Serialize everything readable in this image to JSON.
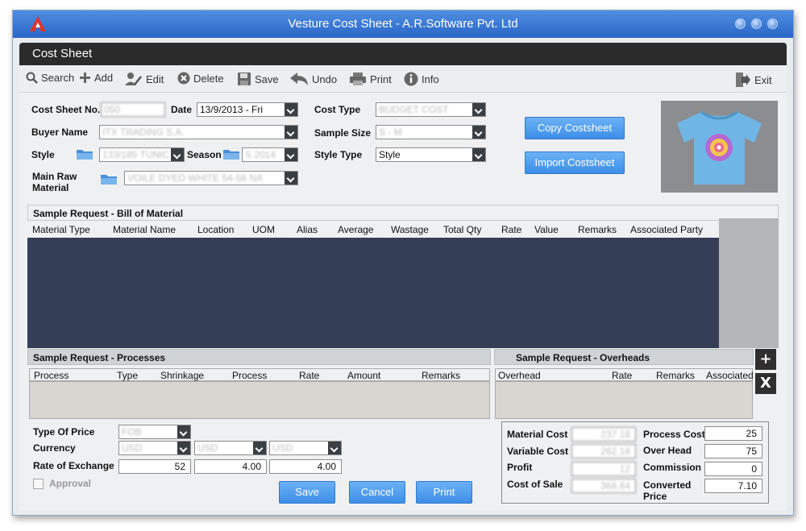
{
  "window": {
    "title": "Vesture Cost Sheet - A.R.Software Pvt. Ltd"
  },
  "panel": {
    "title": "Cost Sheet"
  },
  "toolbar": {
    "search": "Search",
    "add": "Add",
    "edit": "Edit",
    "delete": "Delete",
    "save": "Save",
    "undo": "Undo",
    "print": "Print",
    "info": "Info",
    "exit": "Exit"
  },
  "form": {
    "cost_sheet_no_label": "Cost Sheet No.",
    "cost_sheet_no": "050",
    "date_label": "Date",
    "date": "13/9/2013 - Fri",
    "cost_type_label": "Cost Type",
    "cost_type": "BUDGET COST",
    "buyer_name_label": "Buyer Name",
    "buyer_name": "ITX TRADING S.A.",
    "sample_size_label": "Sample Size",
    "sample_size": "S - M",
    "style_label": "Style",
    "style": "133/185 TUNIC",
    "season_label": "Season",
    "season": "S 2014",
    "style_type_label": "Style Type",
    "style_type": "Style",
    "main_raw_material_label": "Main Raw Material",
    "main_raw_material": "VOILE DYED WHITE 54-56 NA"
  },
  "buttons": {
    "copy": "Copy Costsheet",
    "import": "Import Costsheet",
    "save": "Save",
    "cancel": "Cancel",
    "print": "Print"
  },
  "bom": {
    "title": "Sample Request - Bill of Material",
    "columns": [
      "Material Type",
      "Material Name",
      "Location",
      "UOM",
      "Alias",
      "Average",
      "Wastage",
      "Total Qty",
      "Rate",
      "Value",
      "Remarks",
      "Associated Party"
    ]
  },
  "processes": {
    "title": "Sample Request - Processes",
    "columns": [
      "Process",
      "Type",
      "Shrinkage",
      "Process",
      "Rate",
      "Amount",
      "Remarks"
    ]
  },
  "overheads": {
    "title": "Sample Request - Overheads",
    "columns": [
      "Overhead",
      "Rate",
      "Remarks",
      "Associated"
    ],
    "add": "+",
    "remove": "X"
  },
  "pricing": {
    "type_of_price_label": "Type Of Price",
    "type_of_price": "FOB",
    "currency_label": "Currency",
    "currency_1": "USD",
    "currency_2": "USD",
    "currency_3": "USD",
    "rate_of_exchange_label": "Rate of Exchange",
    "roe_1": "52",
    "roe_2": "4.00",
    "roe_3": "4.00",
    "approval_label": "Approval"
  },
  "totals": {
    "material_cost_label": "Material Cost",
    "material_cost": "237.18",
    "process_cost_label": "Process Cost",
    "process_cost": "25",
    "variable_cost_label": "Variable Cost",
    "variable_cost": "262.18",
    "over_head_label": "Over Head",
    "over_head": "75",
    "profit_label": "Profit",
    "profit": "12",
    "commission_label": "Commission",
    "commission": "0",
    "cost_of_sale_label": "Cost of Sale",
    "cost_of_sale": "368.64",
    "converted_price_label": "Converted Price",
    "converted_price": "7.10"
  }
}
